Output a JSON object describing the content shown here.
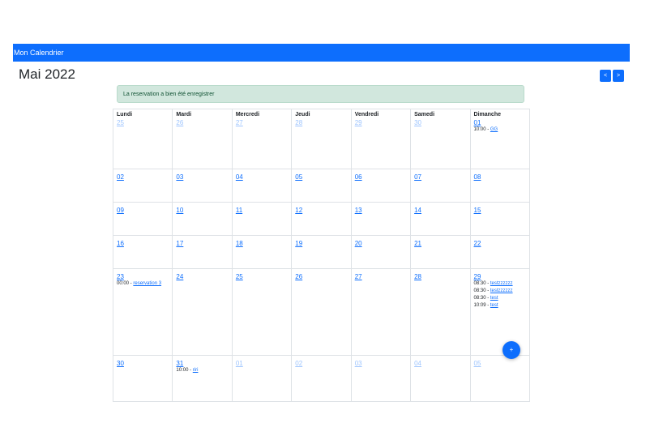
{
  "navbar": {
    "brand": "Mon Calendrier"
  },
  "header": {
    "month_title": "Mai 2022",
    "prev_label": "<",
    "next_label": ">"
  },
  "alert": {
    "message": "La reservation a bien été enregistrer"
  },
  "calendar": {
    "day_names": [
      "Lundi",
      "Mardi",
      "Mercredi",
      "Jeudi",
      "Vendredi",
      "Samedi",
      "Dimanche"
    ],
    "weeks": [
      [
        {
          "day": "25",
          "other": true,
          "events": []
        },
        {
          "day": "26",
          "other": true,
          "events": []
        },
        {
          "day": "27",
          "other": true,
          "events": []
        },
        {
          "day": "28",
          "other": true,
          "events": []
        },
        {
          "day": "29",
          "other": true,
          "events": []
        },
        {
          "day": "30",
          "other": true,
          "events": []
        },
        {
          "day": "01",
          "other": false,
          "events": [
            {
              "time": "10:00",
              "title": "GG"
            }
          ]
        }
      ],
      [
        {
          "day": "02",
          "other": false,
          "events": []
        },
        {
          "day": "03",
          "other": false,
          "events": []
        },
        {
          "day": "04",
          "other": false,
          "events": []
        },
        {
          "day": "05",
          "other": false,
          "events": []
        },
        {
          "day": "06",
          "other": false,
          "events": []
        },
        {
          "day": "07",
          "other": false,
          "events": []
        },
        {
          "day": "08",
          "other": false,
          "events": []
        }
      ],
      [
        {
          "day": "09",
          "other": false,
          "events": []
        },
        {
          "day": "10",
          "other": false,
          "events": []
        },
        {
          "day": "11",
          "other": false,
          "events": []
        },
        {
          "day": "12",
          "other": false,
          "events": []
        },
        {
          "day": "13",
          "other": false,
          "events": []
        },
        {
          "day": "14",
          "other": false,
          "events": []
        },
        {
          "day": "15",
          "other": false,
          "events": []
        }
      ],
      [
        {
          "day": "16",
          "other": false,
          "events": []
        },
        {
          "day": "17",
          "other": false,
          "events": []
        },
        {
          "day": "18",
          "other": false,
          "events": []
        },
        {
          "day": "19",
          "other": false,
          "events": []
        },
        {
          "day": "20",
          "other": false,
          "events": []
        },
        {
          "day": "21",
          "other": false,
          "events": []
        },
        {
          "day": "22",
          "other": false,
          "events": []
        }
      ],
      [
        {
          "day": "23",
          "other": false,
          "events": [
            {
              "time": "00:00",
              "title": "reservation 3"
            }
          ]
        },
        {
          "day": "24",
          "other": false,
          "events": []
        },
        {
          "day": "25",
          "other": false,
          "events": []
        },
        {
          "day": "26",
          "other": false,
          "events": []
        },
        {
          "day": "27",
          "other": false,
          "events": []
        },
        {
          "day": "28",
          "other": false,
          "events": []
        },
        {
          "day": "29",
          "other": false,
          "events": [
            {
              "time": "08:30",
              "title": "testzzzzzz"
            },
            {
              "time": "08:30",
              "title": "testzzzzzz"
            },
            {
              "time": "08:30",
              "title": "test"
            },
            {
              "time": "10:09",
              "title": "test"
            }
          ]
        }
      ],
      [
        {
          "day": "30",
          "other": false,
          "events": []
        },
        {
          "day": "31",
          "other": false,
          "events": [
            {
              "time": "10:00",
              "title": "riri"
            }
          ]
        },
        {
          "day": "01",
          "other": true,
          "events": []
        },
        {
          "day": "02",
          "other": true,
          "events": []
        },
        {
          "day": "03",
          "other": true,
          "events": []
        },
        {
          "day": "04",
          "other": true,
          "events": []
        },
        {
          "day": "05",
          "other": true,
          "events": []
        }
      ]
    ]
  },
  "fab": {
    "label": "+"
  }
}
